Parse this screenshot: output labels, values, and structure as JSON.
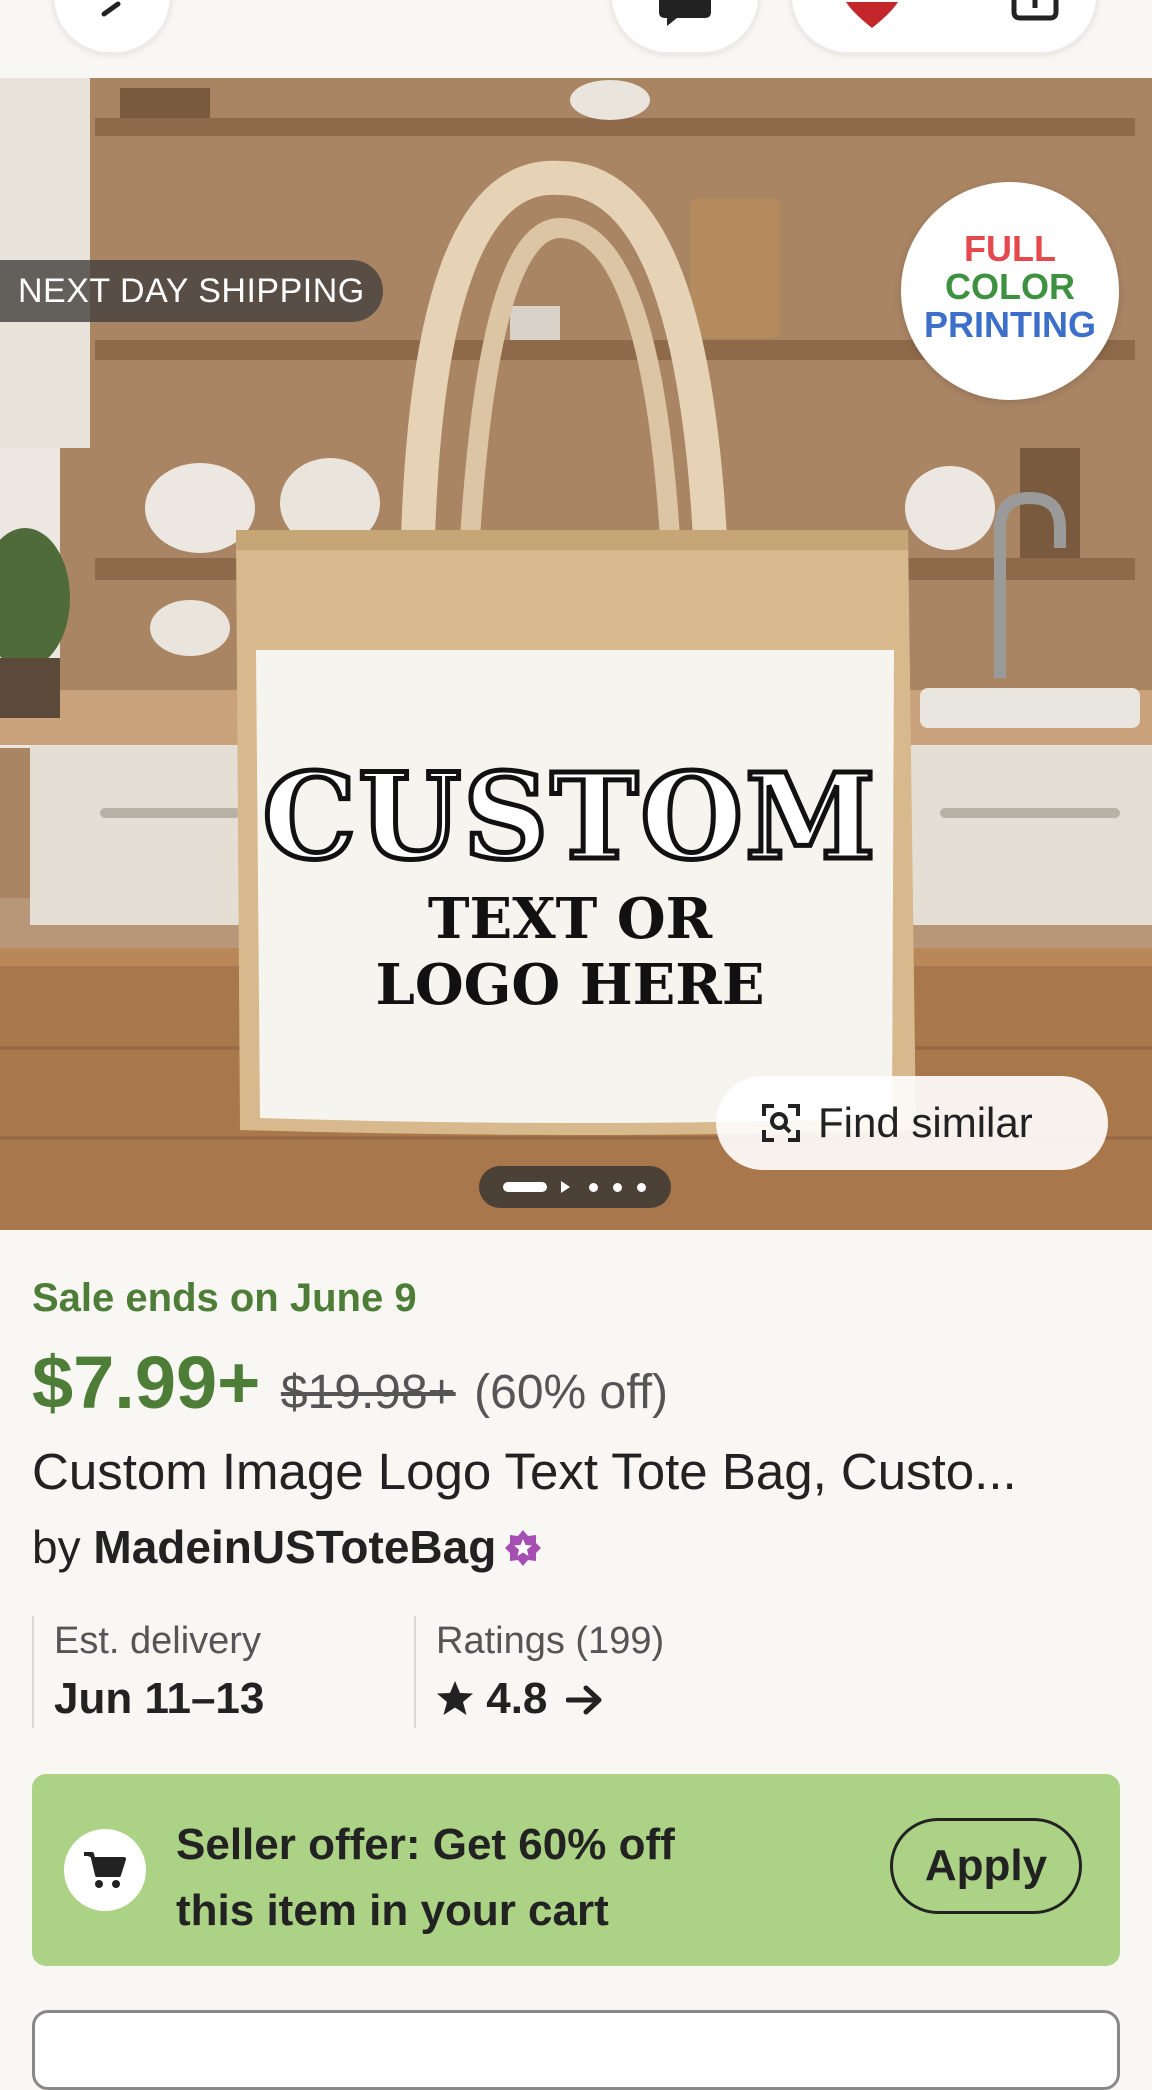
{
  "hero": {
    "shipping_badge": "NEXT DAY SHIPPING",
    "printing_badge": [
      "FULL",
      "COLOR",
      "PRINTING"
    ],
    "printing_colors": [
      "#e5484d",
      "#3f9142",
      "#3b6fc9",
      "#8a4fb8"
    ],
    "bag_print_line1": "CUSTOM",
    "bag_print_line2": "TEXT OR",
    "bag_print_line3": "LOGO HERE",
    "find_similar_label": "Find similar",
    "image_count": 5,
    "active_image": 1
  },
  "listing": {
    "sale_text": "Sale ends on June 9",
    "price": "$7.99+",
    "original_price": "$19.98+",
    "discount": "(60% off)",
    "title": "Custom Image Logo Text Tote Bag, Custo...",
    "by_label": "by",
    "shop_name": "MadeinUSToteBag"
  },
  "stats": {
    "delivery_label": "Est. delivery",
    "delivery_value": "Jun 11–13",
    "ratings_label": "Ratings (199)",
    "rating_value": "4.8"
  },
  "offer": {
    "text": "Seller offer: Get 60% off this item in your cart",
    "apply_label": "Apply"
  },
  "colors": {
    "sale_green": "#4e7d38",
    "offer_bg": "#acd286",
    "star_seller": "#a64fb3",
    "favorite_red": "#c3272b"
  },
  "icons": [
    "back-arrow-icon",
    "message-icon",
    "heart-icon",
    "share-icon",
    "scan-icon",
    "star-icon",
    "arrow-right-icon",
    "cart-icon",
    "star-seller-badge-icon"
  ]
}
